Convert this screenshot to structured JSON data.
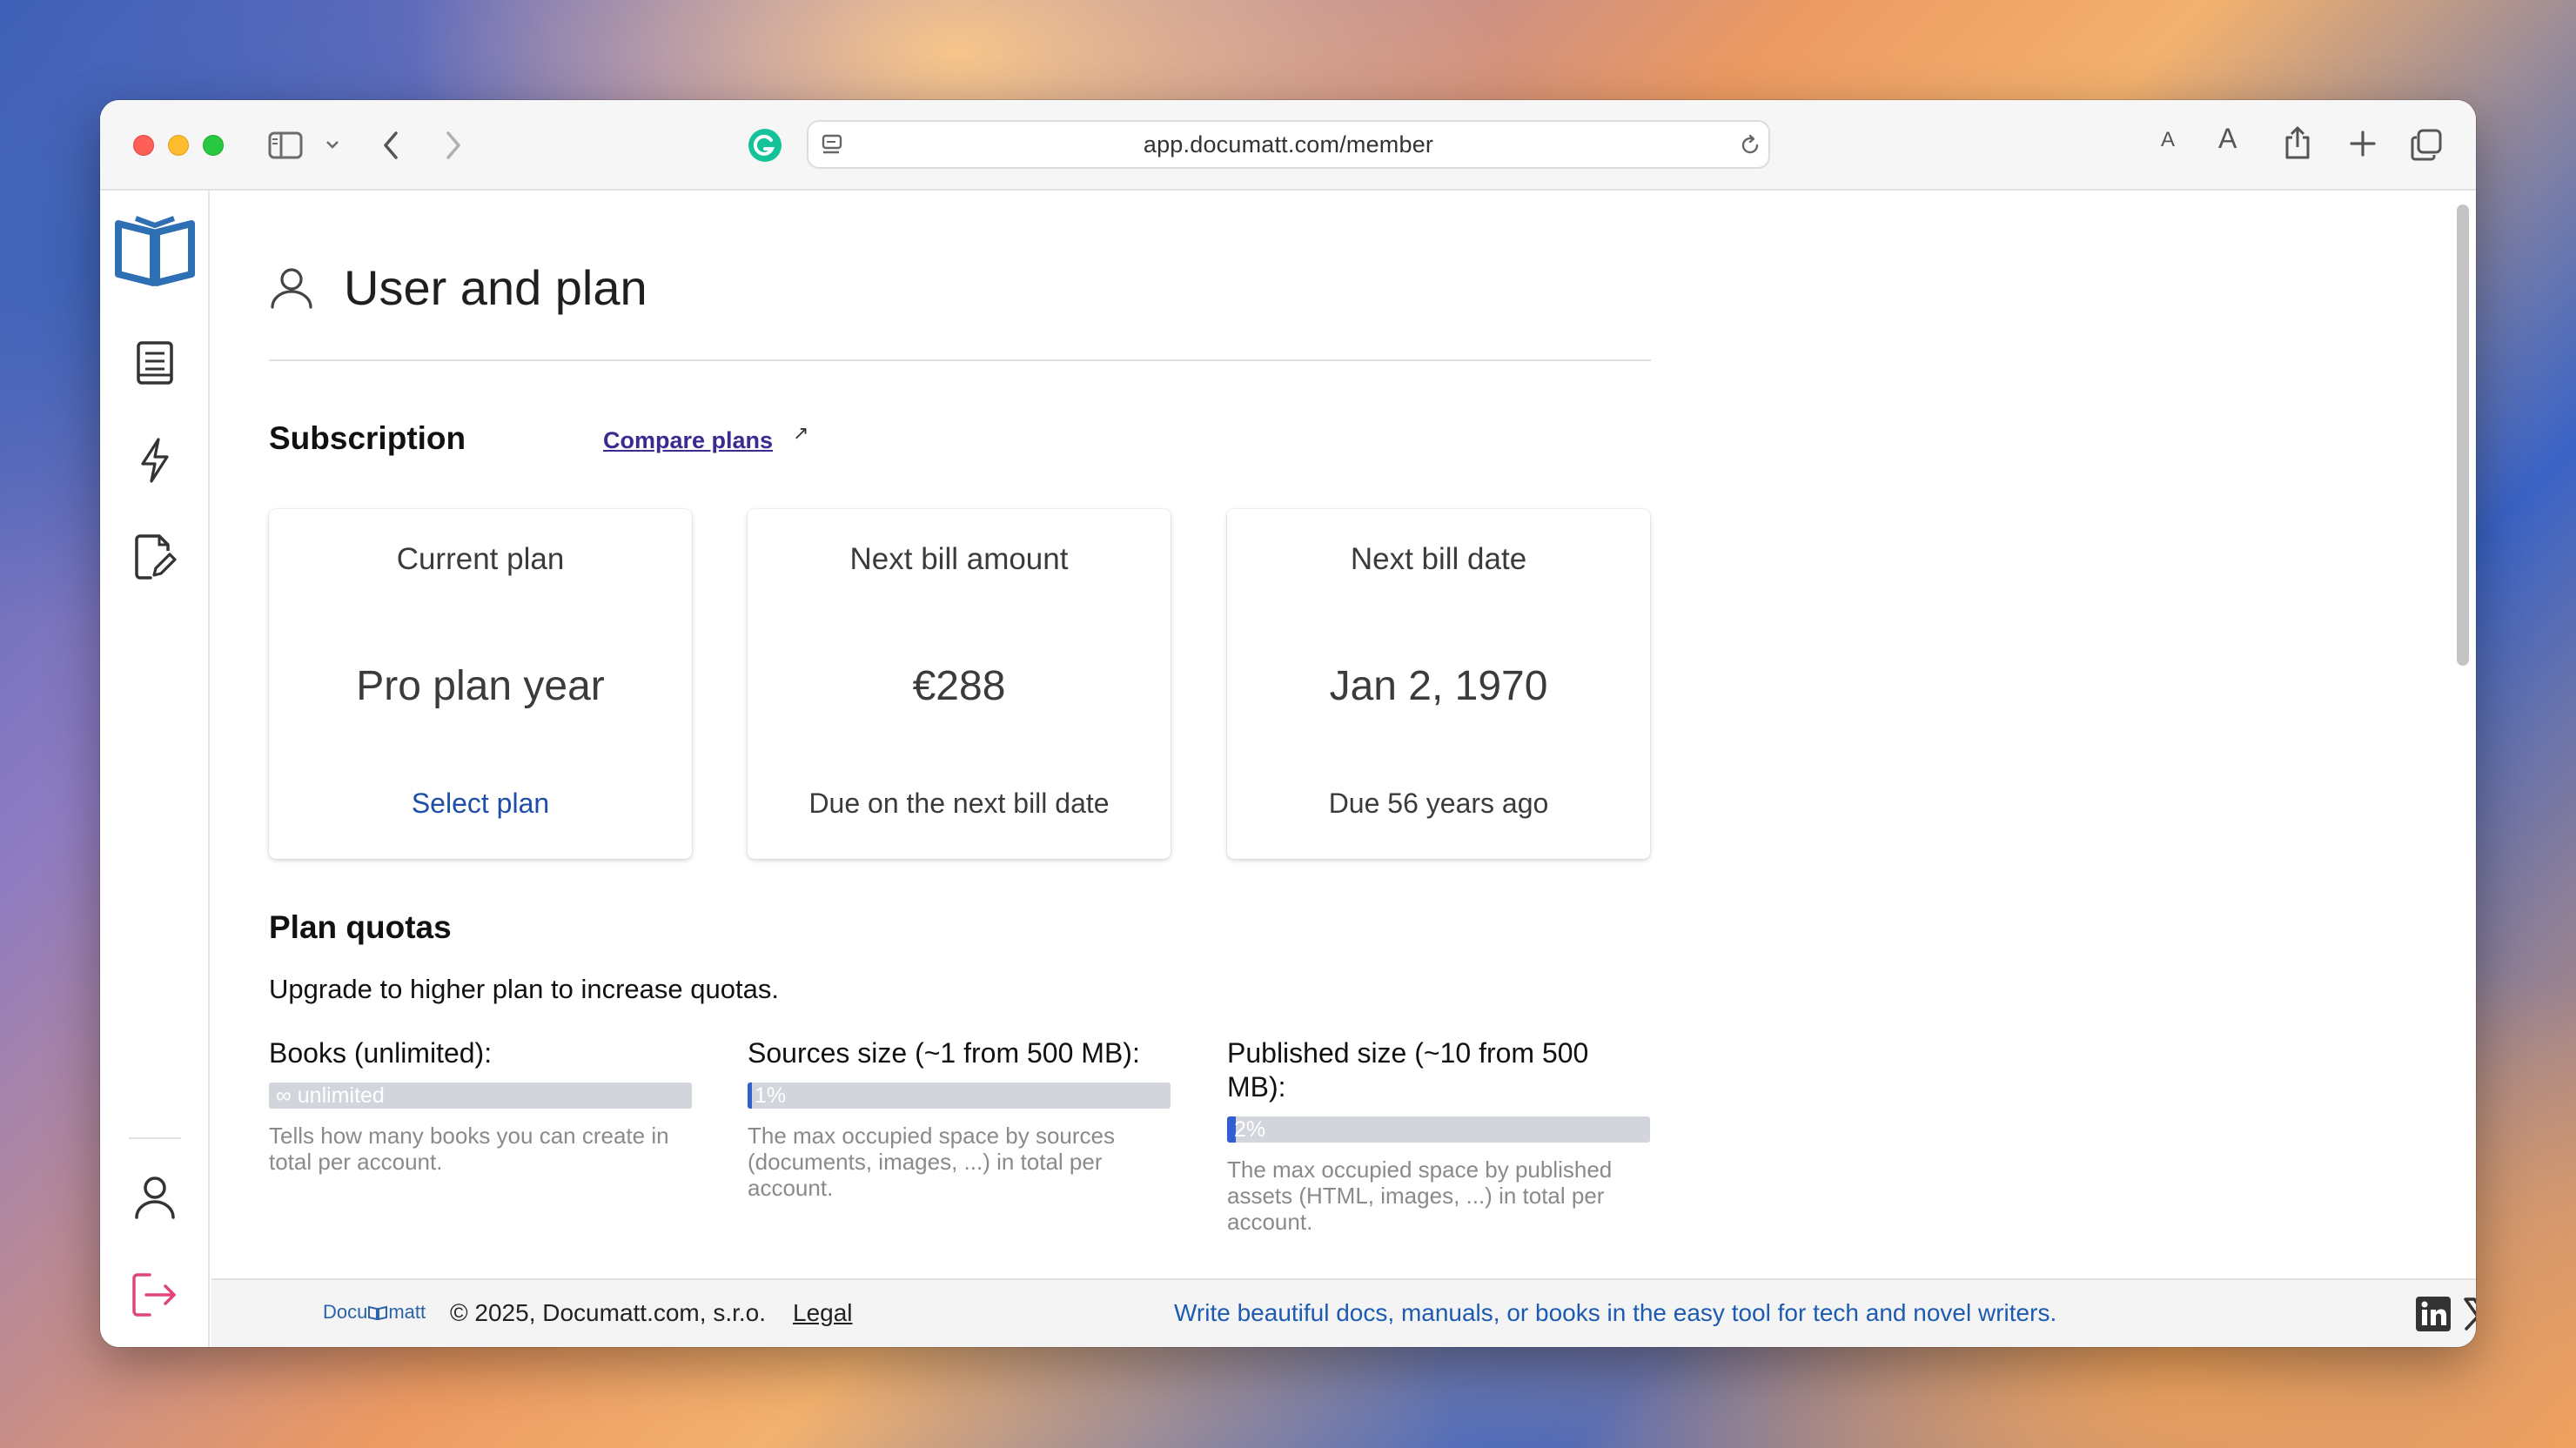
{
  "browser": {
    "url": "app.documatt.com/member",
    "font_small_label": "A",
    "font_large_label": "A"
  },
  "page": {
    "title": "User and plan"
  },
  "subscription": {
    "heading": "Subscription",
    "compare_link": "Compare plans",
    "ext_arrow": "↗",
    "cards": [
      {
        "label": "Current plan",
        "value": "Pro plan year",
        "foot": "Select plan"
      },
      {
        "label": "Next bill amount",
        "value": "€288",
        "foot": "Due on the next bill date"
      },
      {
        "label": "Next bill date",
        "value": "Jan 2, 1970",
        "foot": "Due 56 years ago"
      }
    ]
  },
  "quotas": {
    "heading": "Plan quotas",
    "intro": "Upgrade to higher plan to increase quotas.",
    "items": [
      {
        "label": "Books (unlimited):",
        "bar_text": "∞ unlimited",
        "fill_percent": 0,
        "desc": "Tells how many books you can create in total per account."
      },
      {
        "label": "Sources size (~1 from 500 MB):",
        "bar_text": "1%",
        "fill_percent": 1,
        "desc": "The max occupied space by sources (documents, images, ...) in total per account."
      },
      {
        "label": "Published size (~10 from 500 MB):",
        "bar_text": "2%",
        "fill_percent": 2,
        "desc": "The max occupied space by published assets (HTML, images, ...) in total per account."
      }
    ]
  },
  "footer": {
    "logo_text_left": "Docu",
    "logo_text_right": "matt",
    "copyright": "© 2025, Documatt.com, s.r.o.",
    "legal": "Legal",
    "tagline": "Write beautiful docs, manuals, or books in the easy tool for tech and novel writers."
  },
  "colors": {
    "accent_blue": "#2f6fb4",
    "link_blue": "#1d4fa8",
    "logout_pink": "#e0457b",
    "progress_fill": "#2f5fd0"
  }
}
